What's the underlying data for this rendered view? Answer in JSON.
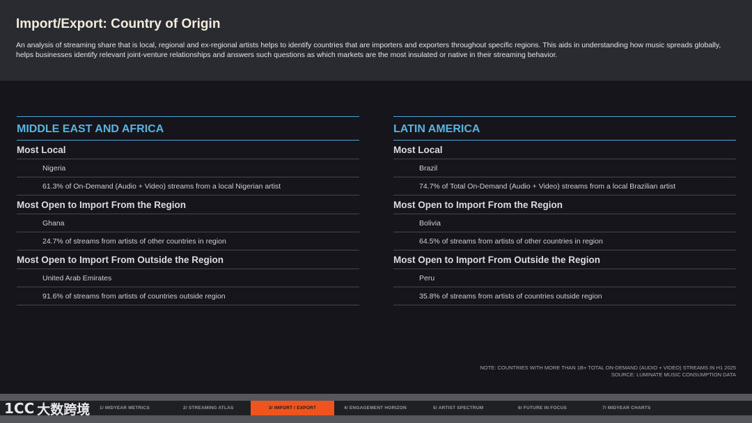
{
  "header": {
    "title": "Import/Export: Country of Origin",
    "description": "An analysis of streaming share that is local, regional and ex-regional artists helps to identify countries that are importers and exporters throughout specific regions. This aids in understanding how music spreads globally, helps businesses identify relevant joint-venture relationships and answers such questions as which markets are the most insulated or native in their streaming behavior."
  },
  "panels": [
    {
      "region": "MIDDLE EAST AND AFRICA",
      "sections": [
        {
          "title": "Most Local",
          "country": "Nigeria",
          "detail": "61.3% of On-Demand (Audio + Video) streams from a local Nigerian artist"
        },
        {
          "title": "Most Open to Import From the Region",
          "country": "Ghana",
          "detail": "24.7% of streams from artists of other countries in region"
        },
        {
          "title": "Most Open to Import From Outside the Region",
          "country": "United Arab Emirates",
          "detail": "91.6% of streams from artists of countries outside region"
        }
      ]
    },
    {
      "region": "LATIN AMERICA",
      "sections": [
        {
          "title": "Most Local",
          "country": "Brazil",
          "detail": "74.7% of Total On-Demand (Audio + Video) streams from a local Brazilian artist"
        },
        {
          "title": "Most Open to Import From the Region",
          "country": "Bolivia",
          "detail": "64.5% of streams from artists of other countries in region"
        },
        {
          "title": "Most Open to Import From Outside the Region",
          "country": "Peru",
          "detail": "35.8% of streams from artists of countries outside region"
        }
      ]
    }
  ],
  "footer": {
    "note": "NOTE: COUNTRIES WITH MORE THAN 1B+ TOTAL ON-DEMAND (AUDIO + VIDEO) STREAMS IN H1 2025",
    "source": "SOURCE: LUMINATE MUSIC CONSUMPTION DATA"
  },
  "nav": {
    "items": [
      {
        "label": "1/ MIDYEAR METRICS"
      },
      {
        "label": "2/ STREAMING ATLAS"
      },
      {
        "label": "3/ IMPORT / EXPORT",
        "active": true
      },
      {
        "label": "4/ ENGAGEMENT HORIZON"
      },
      {
        "label": "5/ ARTIST SPECTRUM"
      },
      {
        "label": "6/ FUTURE IN FOCUS"
      },
      {
        "label": "7/ MIDYEAR CHARTS"
      }
    ],
    "active_color": "#f0541e"
  },
  "watermark": {
    "mark": "1CC",
    "text": "大数跨境"
  },
  "colors": {
    "accent": "#58b4e0",
    "header_bg": "#2a2b30",
    "page_bg": "#16151b"
  }
}
